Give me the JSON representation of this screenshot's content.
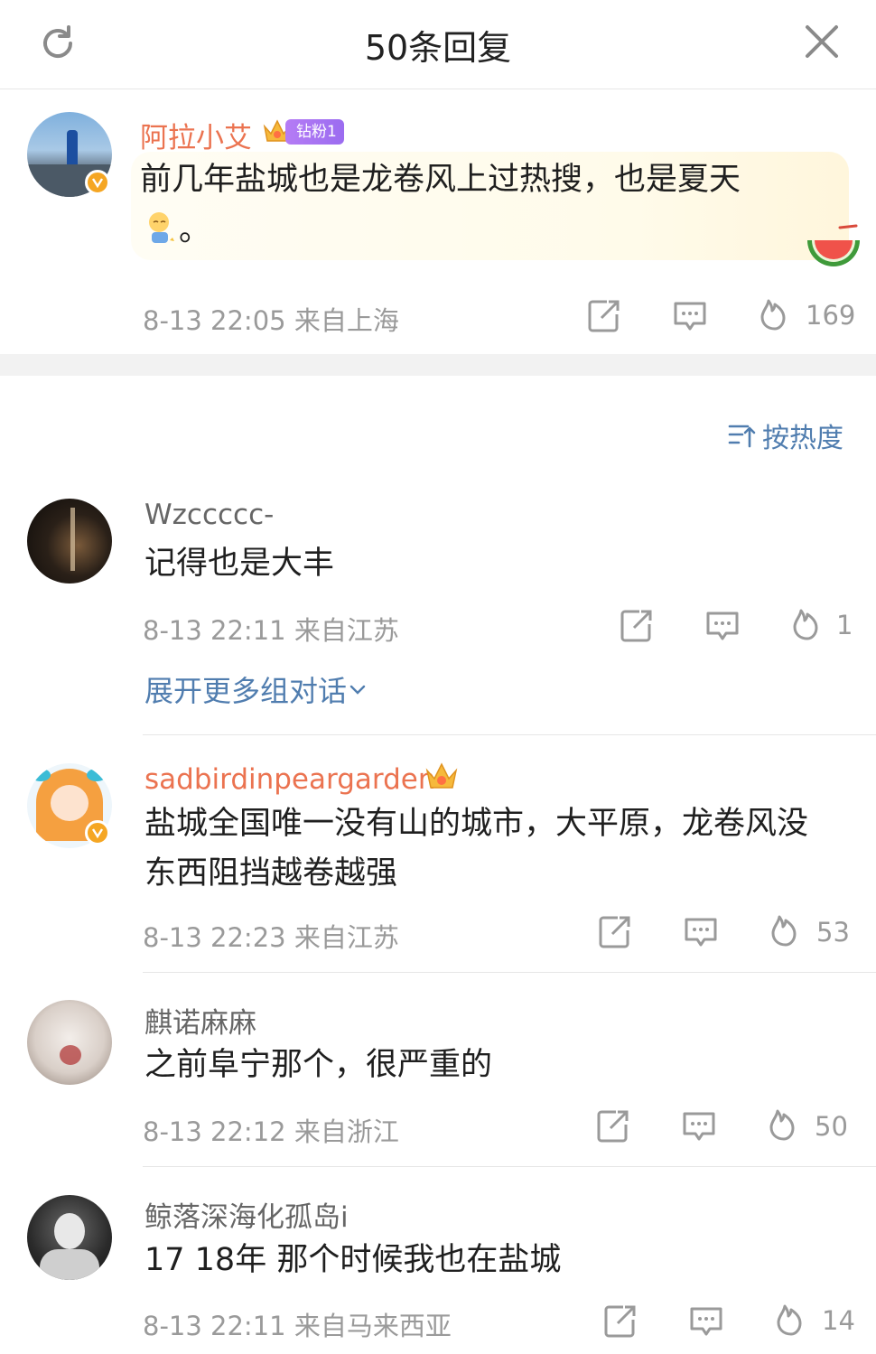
{
  "header": {
    "title": "50条回复",
    "refresh_icon": "refresh-icon",
    "close_icon": "close-icon"
  },
  "root_comment": {
    "user": "阿拉小艾",
    "fan_badge": "钻粉1",
    "text_line1": "前几年盐城也是龙卷风上过热搜，也是夏天",
    "text_line2": "。",
    "time_location": "8-13 22:05  来自上海",
    "likes": "169"
  },
  "sort": {
    "label": "按热度"
  },
  "comments": [
    {
      "user": "Wzccccc-",
      "text_lines": [
        "记得也是大丰"
      ],
      "time_location": "8-13 22:11  来自江苏",
      "likes": "1",
      "expand_label": "展开更多组对话"
    },
    {
      "user": "sadbirdinpeargarden",
      "text_lines": [
        "盐城全国唯一没有山的城市，大平原，龙卷风没",
        "东西阻挡越卷越强"
      ],
      "time_location": "8-13 22:23  来自江苏",
      "likes": "53"
    },
    {
      "user": "麒诺麻麻",
      "text_lines": [
        "之前阜宁那个，很严重的"
      ],
      "time_location": "8-13 22:12  来自浙江",
      "likes": "50"
    },
    {
      "user": "鲸落深海化孤岛i",
      "text_lines": [
        "17  18年    那个时候我也在盐城"
      ],
      "time_location": "8-13 22:11  来自马来西亚",
      "likes": "14"
    }
  ],
  "colors": {
    "link": "#507daf",
    "vip_name": "#eb7350",
    "meta": "#9a9a9a",
    "verified": "#f5a623"
  }
}
